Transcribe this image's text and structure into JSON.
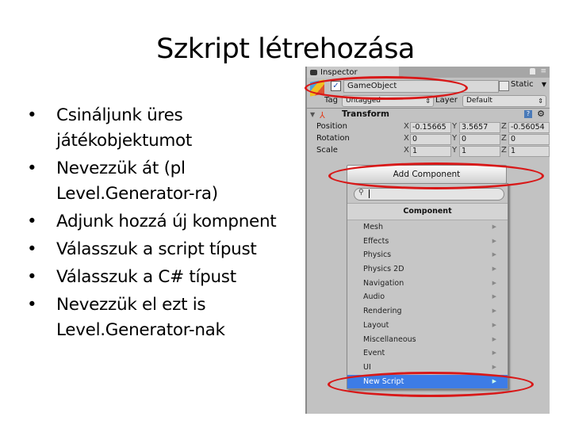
{
  "slide": {
    "title": "Szkript létrehozása",
    "bullets": [
      {
        "line1": "Csináljunk üres",
        "line2": "játékobjektumot"
      },
      {
        "line1": "Nevezzük át (pl",
        "line2": "Level.Generator-ra)"
      },
      {
        "line1": "Adjunk hozzá új kompnent",
        "line2": ""
      },
      {
        "line1": "Válasszuk a script típust",
        "line2": ""
      },
      {
        "line1": "Válasszuk a C# típust",
        "line2": ""
      },
      {
        "line1": "Nevezzük el ezt is",
        "line2": "Level.Generator-nak"
      }
    ],
    "bullet_glyph": "•"
  },
  "inspector": {
    "tab_label": "Inspector",
    "gameobject": {
      "active_check": "✓",
      "name": "GameObject",
      "static_label": "Static",
      "tag_label": "Tag",
      "tag_value": "Untagged",
      "layer_label": "Layer",
      "layer_value": "Default"
    },
    "transform": {
      "title": "Transform",
      "rows": [
        {
          "label": "Position",
          "x": "-0.15665",
          "y": "3.5657",
          "z": "-0.56054"
        },
        {
          "label": "Rotation",
          "x": "0",
          "y": "0",
          "z": "0"
        },
        {
          "label": "Scale",
          "x": "1",
          "y": "1",
          "z": "1"
        }
      ],
      "axis_labels": [
        "X",
        "Y",
        "Z"
      ]
    },
    "add_component_label": "Add Component",
    "component_popup": {
      "search_value": "",
      "header": "Component",
      "items": [
        {
          "label": "Mesh",
          "selected": false
        },
        {
          "label": "Effects",
          "selected": false
        },
        {
          "label": "Physics",
          "selected": false
        },
        {
          "label": "Physics 2D",
          "selected": false
        },
        {
          "label": "Navigation",
          "selected": false
        },
        {
          "label": "Audio",
          "selected": false
        },
        {
          "label": "Rendering",
          "selected": false
        },
        {
          "label": "Layout",
          "selected": false
        },
        {
          "label": "Miscellaneous",
          "selected": false
        },
        {
          "label": "Event",
          "selected": false
        },
        {
          "label": "UI",
          "selected": false
        },
        {
          "label": "New Script",
          "selected": true
        }
      ]
    }
  },
  "highlight_color": "#d81818",
  "selection_color": "#3d7ce6"
}
